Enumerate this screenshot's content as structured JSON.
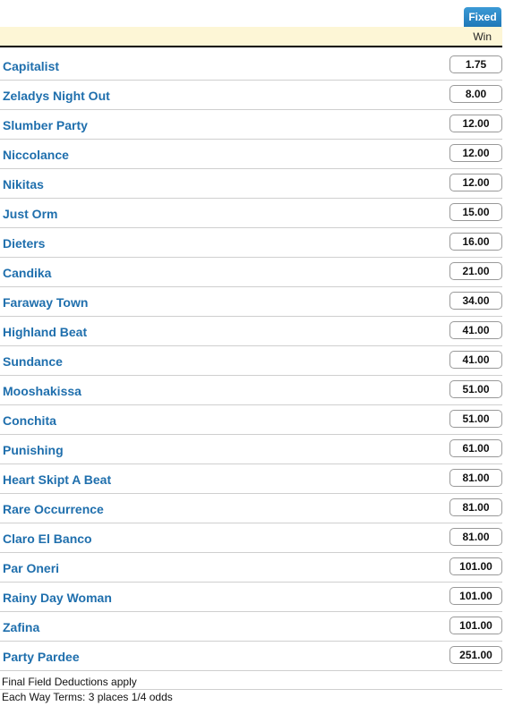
{
  "header": {
    "badge": "Fixed",
    "column": "Win"
  },
  "runners": [
    {
      "name": "Capitalist",
      "win": "1.75"
    },
    {
      "name": "Zeladys Night Out",
      "win": "8.00"
    },
    {
      "name": "Slumber Party",
      "win": "12.00"
    },
    {
      "name": "Niccolance",
      "win": "12.00"
    },
    {
      "name": "Nikitas",
      "win": "12.00"
    },
    {
      "name": "Just Orm",
      "win": "15.00"
    },
    {
      "name": "Dieters",
      "win": "16.00"
    },
    {
      "name": "Candika",
      "win": "21.00"
    },
    {
      "name": "Faraway Town",
      "win": "34.00"
    },
    {
      "name": "Highland Beat",
      "win": "41.00"
    },
    {
      "name": "Sundance",
      "win": "41.00"
    },
    {
      "name": "Mooshakissa",
      "win": "51.00"
    },
    {
      "name": "Conchita",
      "win": "51.00"
    },
    {
      "name": "Punishing",
      "win": "61.00"
    },
    {
      "name": "Heart Skipt A Beat",
      "win": "81.00"
    },
    {
      "name": "Rare Occurrence",
      "win": "81.00"
    },
    {
      "name": "Claro El Banco",
      "win": "81.00"
    },
    {
      "name": "Par Oneri",
      "win": "101.00"
    },
    {
      "name": "Rainy Day Woman",
      "win": "101.00"
    },
    {
      "name": "Zafina",
      "win": "101.00"
    },
    {
      "name": "Party Pardee",
      "win": "251.00"
    }
  ],
  "footer": {
    "deductions": "Final Field Deductions apply",
    "each_way": "Each Way Terms: 3 places 1/4 odds"
  }
}
